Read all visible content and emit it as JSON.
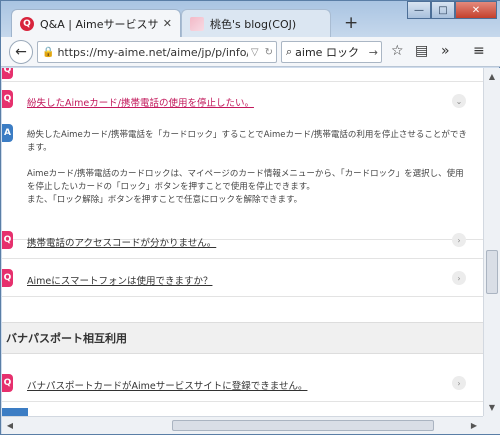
{
  "tabs": [
    {
      "title": "Q&A | Aimeサービスサ…",
      "favicon_letter": "Q"
    },
    {
      "title": "桃色's blog(COJ)"
    }
  ],
  "toolbar": {
    "back": "←",
    "url": "https://my-aime.net/aime/jp/p/info/faq.ht",
    "search_query": "aime ロック",
    "new_tab": "+",
    "go": "→"
  },
  "window_controls": {
    "minimize": "—",
    "maximize": "□",
    "close": "✕"
  },
  "faq": {
    "q_letter": "Q",
    "a_letter": "A",
    "open_question": "紛失したAimeカード/携帯電話の使用を停止したい。",
    "answer_lines": [
      "紛失したAimeカード/携帯電話を「カードロック」することでAimeカード/携帯電話の利用を停止させることができます。",
      "Aimeカード/携帯電話のカードロックは、マイページのカード情報メニューから、「カードロック」を選択し、使用を停止したいカードの「ロック」ボタンを押すことで使用を停止できます。\nまた、「ロック解除」ボタンを押すことで任意にロックを解除できます。"
    ],
    "questions": [
      "携帯電話のアクセスコードが分かりません。",
      "Aimeにスマートフォンは使用できますか？"
    ],
    "section_title": "バナパスポート相互利用",
    "section_questions": [
      "バナパスポートカードがAimeサービスサイトに登録できません。"
    ]
  },
  "colors": {
    "accent": "#e6306d",
    "answer": "#3c7dc4",
    "open_link": "#c2185b"
  }
}
